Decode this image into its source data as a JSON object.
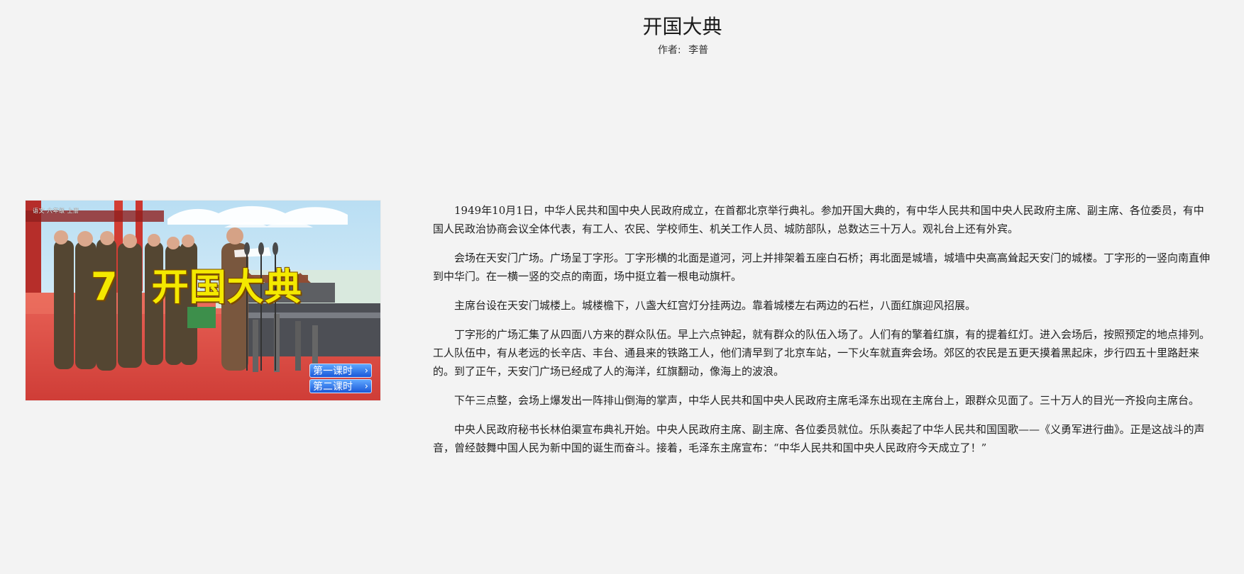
{
  "article": {
    "title": "开国大典",
    "author_label": "作者:",
    "author_name": "李普"
  },
  "cover": {
    "top_text": "语文  六年级  上册",
    "number": "7",
    "title": "开国大典",
    "lesson_buttons": [
      "第一课时",
      "第二课时"
    ]
  },
  "paragraphs": [
    "1949年10月1日，中华人民共和国中央人民政府成立，在首都北京举行典礼。参加开国大典的，有中华人民共和国中央人民政府主席、副主席、各位委员，有中国人民政治协商会议全体代表，有工人、农民、学校师生、机关工作人员、城防部队，总数达三十万人。观礼台上还有外宾。",
    "会场在天安门广场。广场呈丁字形。丁字形横的北面是道河，河上并排架着五座白石桥；再北面是城墙，城墙中央高高耸起天安门的城楼。丁字形的一竖向南直伸到中华门。在一横一竖的交点的南面，场中挺立着一根电动旗杆。",
    "主席台设在天安门城楼上。城楼檐下，八盏大红宫灯分挂两边。靠着城楼左右两边的石栏，八面红旗迎风招展。",
    "丁字形的广场汇集了从四面八方来的群众队伍。早上六点钟起，就有群众的队伍入场了。人们有的擎着红旗，有的提着红灯。进入会场后，按照预定的地点排列。工人队伍中，有从老远的长辛店、丰台、通县来的铁路工人，他们清早到了北京车站，一下火车就直奔会场。郊区的农民是五更天摸着黑起床，步行四五十里路赶来的。到了正午，天安门广场已经成了人的海洋，红旗翻动，像海上的波浪。",
    "下午三点整，会场上爆发出一阵排山倒海的掌声，中华人民共和国中央人民政府主席毛泽东出现在主席台上，跟群众见面了。三十万人的目光一齐投向主席台。",
    "中央人民政府秘书长林伯渠宣布典礼开始。中央人民政府主席、副主席、各位委员就位。乐队奏起了中华人民共和国国歌——《义勇军进行曲》。正是这战斗的声音，曾经鼓舞中国人民为新中国的诞生而奋斗。接着，毛泽东主席宣布：“中华人民共和国中央人民政府今天成立了！”"
  ]
}
